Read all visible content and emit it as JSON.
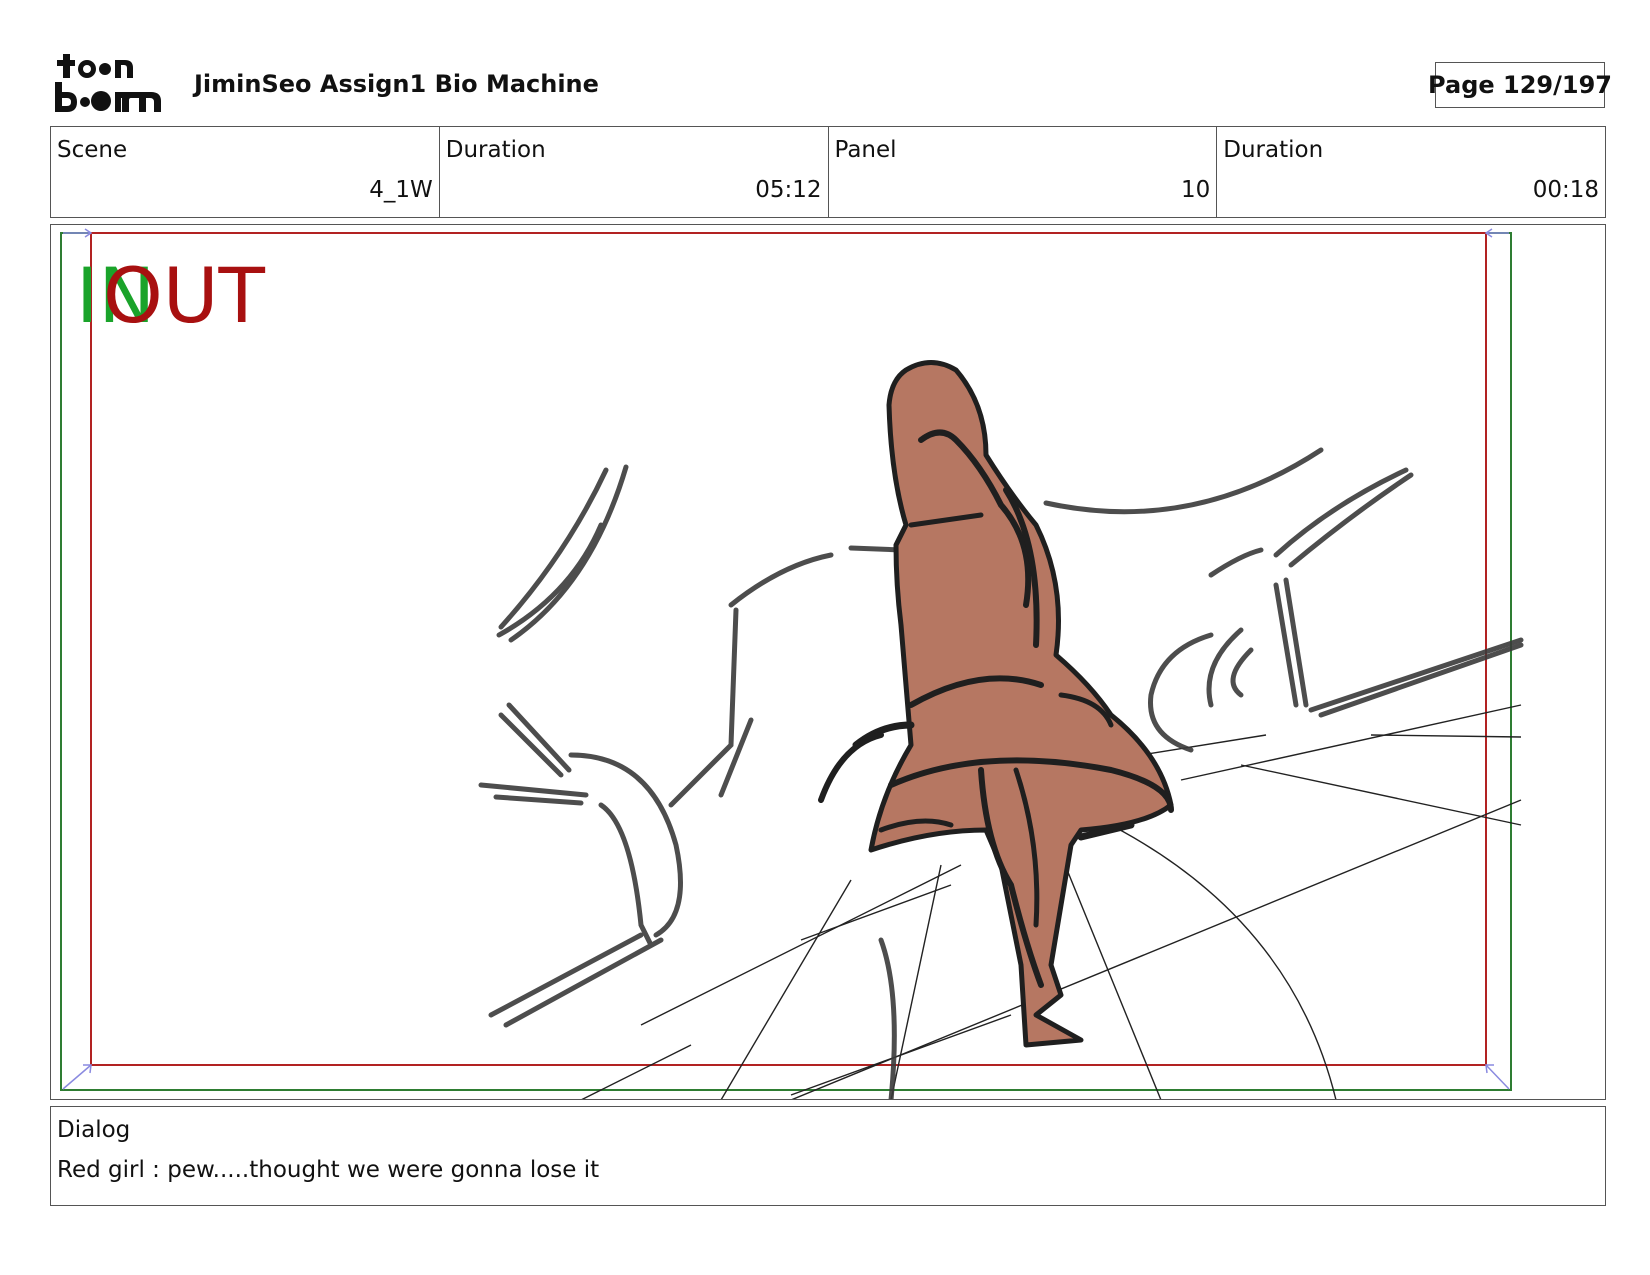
{
  "header": {
    "logo_text": "toon boom",
    "title": "JiminSeo Assign1 Bio Machine",
    "page": "Page 129/197"
  },
  "info": {
    "scene_label": "Scene",
    "scene_value": "4_1W",
    "scene_duration_label": "Duration",
    "scene_duration_value": "05:12",
    "panel_label": "Panel",
    "panel_value": "10",
    "panel_duration_label": "Duration",
    "panel_duration_value": "00:18"
  },
  "panel": {
    "in_label": "IN",
    "out_label": "OUT",
    "in_color": "#1aa32a",
    "out_color": "#a81010",
    "figure_color": "#b67762",
    "sketch_color": "#333333",
    "safe_frame_color": "#2e7d32",
    "action_frame_color": "#b22222"
  },
  "dialog": {
    "label": "Dialog",
    "text": "Red girl : pew.....thought we were gonna lose it"
  }
}
